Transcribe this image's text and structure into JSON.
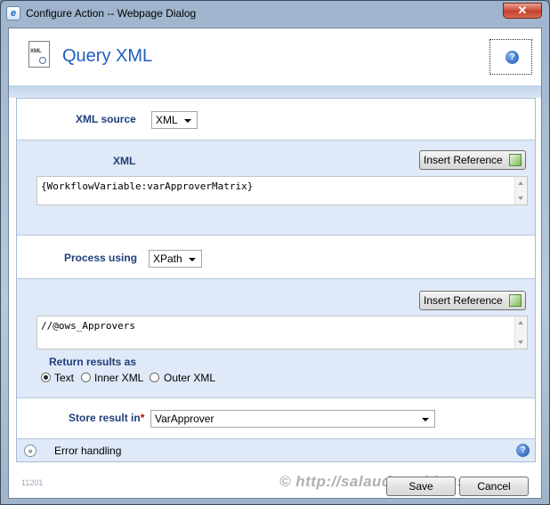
{
  "window": {
    "title": "Configure Action -- Webpage Dialog",
    "close_glyph": "✕"
  },
  "header": {
    "title": "Query XML",
    "icon_text": "XML",
    "help_glyph": "?"
  },
  "form": {
    "xml_source": {
      "label": "XML source",
      "value": "XML"
    },
    "xml": {
      "label": "XML",
      "insert_reference_label": "Insert Reference",
      "value": "{WorkflowVariable:varApproverMatrix}"
    },
    "process_using": {
      "label": "Process using",
      "value": "XPath"
    },
    "xpath": {
      "insert_reference_label": "Insert Reference",
      "value": "//@ows_Approvers"
    },
    "return_results": {
      "label": "Return results as",
      "options": [
        "Text",
        "Inner XML",
        "Outer XML"
      ],
      "selected": "Text"
    },
    "store_result": {
      "label": "Store result in",
      "required_mark": "*",
      "value": "VarApprover"
    },
    "error_handling": {
      "label": "Error handling",
      "expand_glyph": "»",
      "help_glyph": "?"
    }
  },
  "footer": {
    "build_number": "11201",
    "watermark": "© http://salaudeen.blogspot.com",
    "save_label": "Save",
    "cancel_label": "Cancel"
  }
}
